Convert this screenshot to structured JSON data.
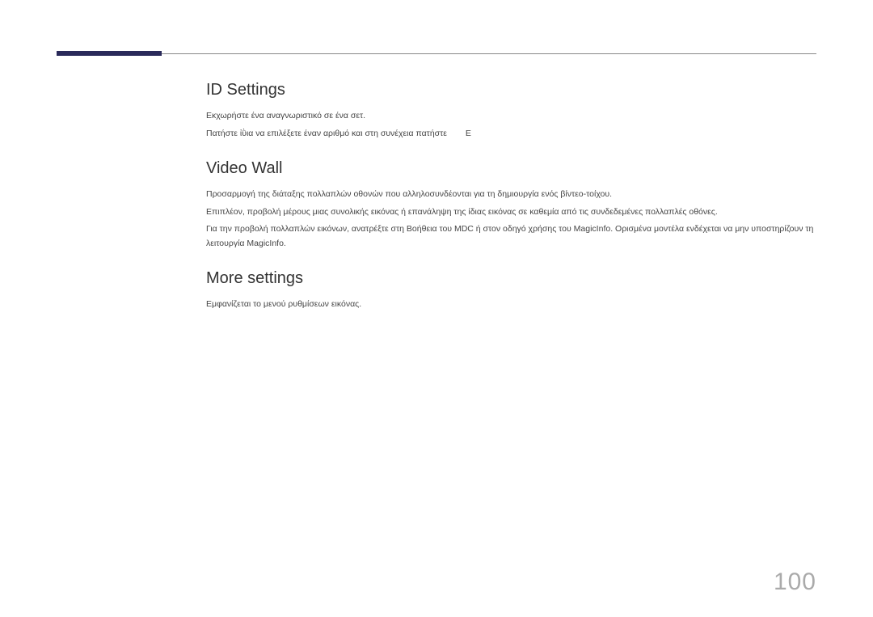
{
  "page_number": "100",
  "sections": {
    "id_settings": {
      "heading": "ID Settings",
      "line1": "Εκχωρήστε ένα αναγνωριστικό σε ένα σετ.",
      "line2_part1": "Πατήστε ἰῢια να επιλέξετε έναν αριθμό και στη συνέχεια πατήστε",
      "line2_part2": "E"
    },
    "video_wall": {
      "heading": "Video Wall",
      "line1": "Προσαρμογή της διάταξης πολλαπλών οθονών που αλληλοσυνδέονται για τη δημιουργία ενός βίντεο-τοίχου.",
      "line2": "Επιπλέον, προβολή μέρους μιας συνολικής εικόνας ή επανάληψη της ίδιας εικόνας σε καθεμία από τις συνδεδεμένες πολλαπλές οθόνες.",
      "line3": "Για την προβολή πολλαπλών εικόνων, ανατρέξτε στη Βοήθεια του MDC ή στον οδηγό χρήσης του MagicInfo. Ορισμένα μοντέλα ενδέχεται να μην υποστηρίζουν τη λειτουργία MagicInfo."
    },
    "more_settings": {
      "heading": "More settings",
      "line1": "Εμφανίζεται το μενού ρυθμίσεων εικόνας."
    }
  }
}
